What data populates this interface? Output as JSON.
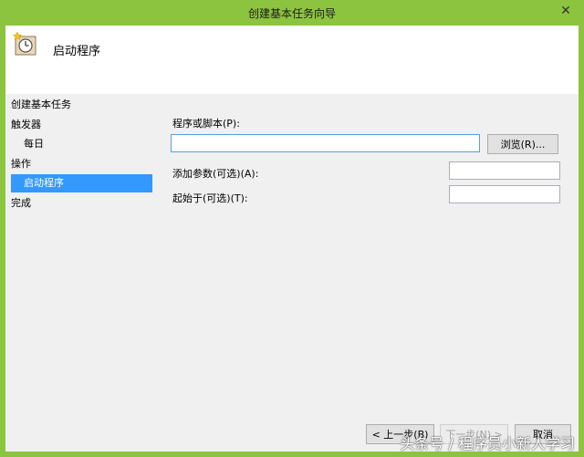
{
  "window": {
    "title": "创建基本任务向导",
    "close_glyph": "✕"
  },
  "header": {
    "icon": "task-clock-icon",
    "title": "启动程序"
  },
  "sidebar": {
    "section_title": "创建基本任务",
    "items": [
      {
        "label": "触发器"
      },
      {
        "label": "每日"
      },
      {
        "label": "操作"
      },
      {
        "label": "启动程序",
        "selected": true
      },
      {
        "label": "完成"
      }
    ]
  },
  "form": {
    "program_label": "程序或脚本(P):",
    "program_value": "",
    "browse_label": "浏览(R)...",
    "args_label": "添加参数(可选)(A):",
    "args_value": "",
    "start_in_label": "起始于(可选)(T):",
    "start_in_value": ""
  },
  "footer": {
    "back_label": "< 上一步(B)",
    "next_label": "下一步(N) >",
    "cancel_label": "取消"
  },
  "watermark": "头条号 / 程序员小新人学习",
  "colors": {
    "frame": "#8dc43f",
    "selection": "#3399ff"
  }
}
